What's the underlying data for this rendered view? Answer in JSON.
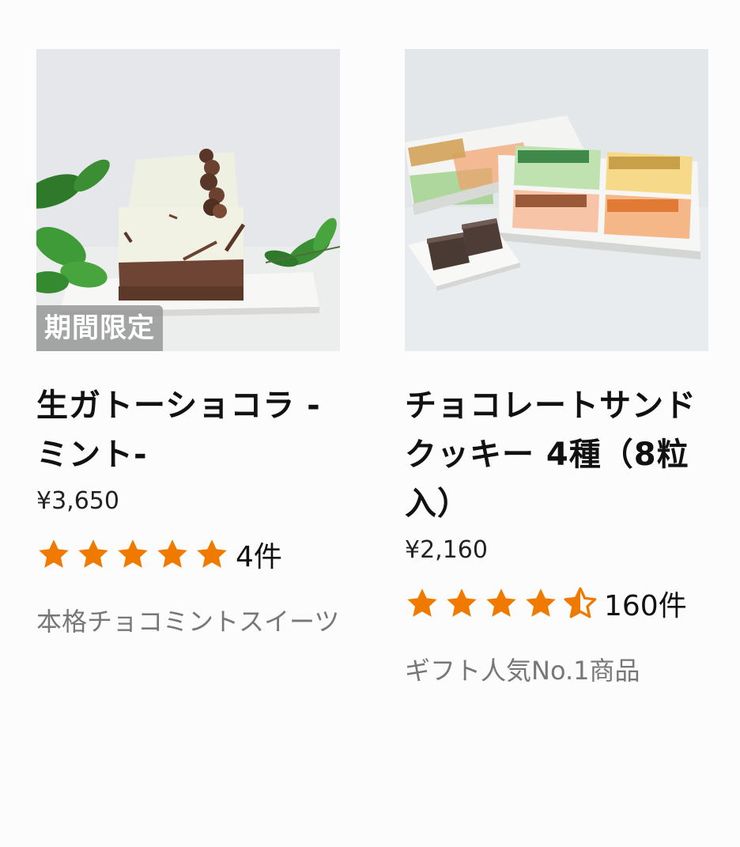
{
  "colors": {
    "star": "#f07a00",
    "badge_bg": "#969696",
    "desc_text": "#777777"
  },
  "products": [
    {
      "image_icon": "mint-gateau-chocolat-photo",
      "badge": "期間限定",
      "title": "生ガトーショコラ - ミント-",
      "price": "¥3,650",
      "rating": 5,
      "review_count": "4件",
      "description": "本格チョコミントスイーツ"
    },
    {
      "image_icon": "chocolate-sand-cookie-box-photo",
      "badge": "",
      "title": "チョコレートサンドクッキー 4種（8粒入）",
      "price": "¥2,160",
      "rating": 4.5,
      "review_count": "160件",
      "description": "ギフト人気No.1商品"
    }
  ]
}
